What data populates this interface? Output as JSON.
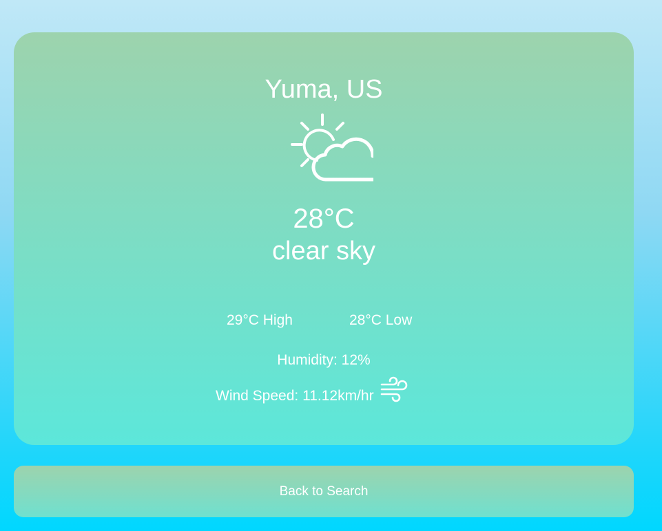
{
  "weather": {
    "location": "Yuma, US",
    "icon": "partly-cloudy-icon",
    "temperature": "28°C",
    "description": "clear sky",
    "high": "29°C High",
    "low": "28°C Low",
    "humidity": "Humidity: 12%",
    "wind_speed": "Wind Speed: 11.12km/hr",
    "wind_icon": "wind-icon"
  },
  "actions": {
    "back_label": "Back to Search"
  },
  "colors": {
    "text": "#ffffff",
    "card_top": "#9dd3ad",
    "card_bottom": "#5ce7da",
    "page_top": "#c0e8f7",
    "page_bottom": "#00d7ff"
  }
}
